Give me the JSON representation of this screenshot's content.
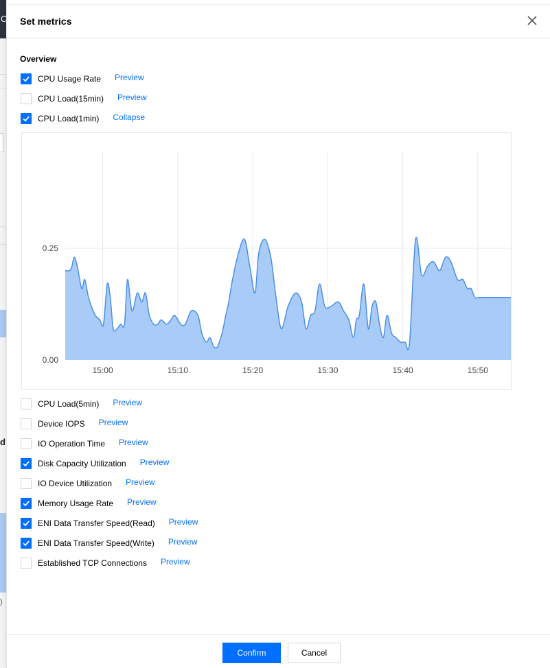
{
  "background": {
    "header_char": "C",
    "side_char": "d",
    "side_char2": ")"
  },
  "drawer": {
    "title": "Set metrics",
    "section_title": "Overview"
  },
  "metrics_top": [
    {
      "label": "CPU Usage Rate",
      "checked": true,
      "link": "Preview"
    },
    {
      "label": "CPU Load(15min)",
      "checked": false,
      "link": "Preview"
    },
    {
      "label": "CPU Load(1min)",
      "checked": true,
      "link": "Collapse"
    }
  ],
  "metrics_bottom": [
    {
      "label": "CPU Load(5min)",
      "checked": false,
      "link": "Preview"
    },
    {
      "label": "Device IOPS",
      "checked": false,
      "link": "Preview"
    },
    {
      "label": "IO Operation Time",
      "checked": false,
      "link": "Preview"
    },
    {
      "label": "Disk Capacity Utilization",
      "checked": true,
      "link": "Preview"
    },
    {
      "label": "IO Device Utilization",
      "checked": false,
      "link": "Preview"
    },
    {
      "label": "Memory Usage Rate",
      "checked": true,
      "link": "Preview"
    },
    {
      "label": "ENI Data Transfer Speed(Read)",
      "checked": true,
      "link": "Preview"
    },
    {
      "label": "ENI Data Transfer Speed(Write)",
      "checked": true,
      "link": "Preview"
    },
    {
      "label": "Established TCP Connections",
      "checked": false,
      "link": "Preview"
    }
  ],
  "footer": {
    "confirm": "Confirm",
    "cancel": "Cancel"
  },
  "colors": {
    "accent": "#006eff",
    "area_fill": "#a9cbf7",
    "area_line": "#4a8fe8"
  },
  "chart_data": {
    "type": "area",
    "x_ticks": [
      "15:00",
      "15:10",
      "15:20",
      "15:30",
      "15:40",
      "15:50"
    ],
    "y_ticks": [
      "0.00",
      "0.25"
    ],
    "x_range": [
      "14:55",
      "15:54"
    ],
    "ylim": [
      0,
      0.25
    ],
    "grid": "vertical lines at x ticks, horizontal line at 0.25",
    "x_minutes_from_1455": [
      0,
      0.6,
      0.9,
      1.2,
      1.6,
      2.2,
      2.6,
      3.1,
      3.5,
      4,
      4.6,
      5.1,
      5.6,
      6,
      6.4,
      6.9,
      7.4,
      7.9,
      8.3,
      8.9,
      9.6,
      10.2,
      10.7,
      11.2,
      11.8,
      12.3,
      12.8,
      13.5,
      14.1,
      14.6,
      15.4,
      16,
      16.8,
      17.7,
      18.2,
      18.8,
      19.3,
      19.8,
      20.3,
      20.9,
      21.4,
      21.8,
      22.3,
      23.1,
      23.9,
      24.6,
      25.3,
      25.8,
      26.6,
      27.4,
      28.1,
      28.8,
      29.7,
      30.7,
      31.5,
      32.1,
      32.7,
      33.3,
      33.9,
      34.6,
      35.4,
      36.4,
      37.1,
      37.8,
      38.4,
      38.8,
      39.2,
      39.8,
      40.4,
      40.9,
      41.4,
      41.9,
      42.4,
      42.9,
      43.5,
      44.1,
      44.7,
      45.3,
      45.9,
      46.7,
      47.5,
      48.3,
      49.1,
      49.9,
      50.7,
      51.4,
      52.3,
      53,
      53.6,
      54.1,
      54.6,
      55.1,
      55.6,
      56.2,
      56.8,
      57.5,
      58.1,
      58.7,
      59.4
    ],
    "values": [
      0.2,
      0.2,
      0.21,
      0.23,
      0.21,
      0.16,
      0.18,
      0.14,
      0.12,
      0.1,
      0.09,
      0.08,
      0.17,
      0.14,
      0.07,
      0.07,
      0.08,
      0.08,
      0.18,
      0.11,
      0.15,
      0.13,
      0.15,
      0.1,
      0.08,
      0.08,
      0.09,
      0.08,
      0.09,
      0.1,
      0.08,
      0.08,
      0.11,
      0.1,
      0.06,
      0.04,
      0.05,
      0.03,
      0.03,
      0.06,
      0.1,
      0.13,
      0.18,
      0.24,
      0.27,
      0.21,
      0.15,
      0.24,
      0.27,
      0.23,
      0.14,
      0.07,
      0.12,
      0.15,
      0.13,
      0.07,
      0.1,
      0.11,
      0.17,
      0.12,
      0.12,
      0.13,
      0.11,
      0.09,
      0.05,
      0.09,
      0.1,
      0.17,
      0.07,
      0.12,
      0.13,
      0.08,
      0.05,
      0.1,
      0.06,
      0.05,
      0.04,
      0.04,
      0.04,
      0.27,
      0.19,
      0.21,
      0.22,
      0.2,
      0.23,
      0.22,
      0.18,
      0.18,
      0.16,
      0.16,
      0.14,
      0.14,
      0.14,
      0.14,
      0.14,
      0.14,
      0.14,
      0.14,
      0.14
    ]
  }
}
